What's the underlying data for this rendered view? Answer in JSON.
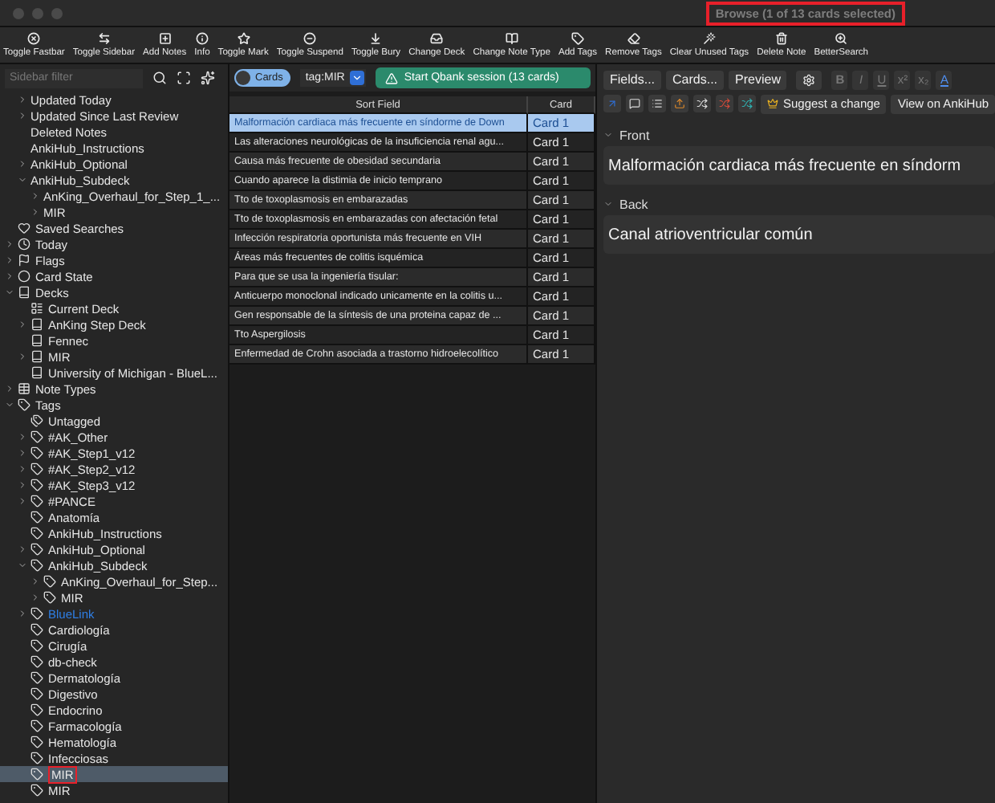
{
  "window": {
    "title": "Browse (1 of 13 cards selected)",
    "title_highlighted": true
  },
  "toolbar": [
    "Toggle Fastbar",
    "Toggle Sidebar",
    "Add Notes",
    "Info",
    "Toggle Mark",
    "Toggle Suspend",
    "Toggle Bury",
    "Change Deck",
    "Change Note Type",
    "Add Tags",
    "Remove Tags",
    "Clear Unused Tags",
    "Delete Note",
    "BetterSearch"
  ],
  "sidebar": {
    "filter_placeholder": "Sidebar filter",
    "partial_items": [
      {
        "label": "Updated Today",
        "expanded": false,
        "selected": false,
        "highlighted": false
      },
      {
        "label": "Updated Since Last Review",
        "expanded": false,
        "selected": false,
        "highlighted": false
      },
      {
        "label": "Deleted Notes",
        "selected": false,
        "highlighted": false
      },
      {
        "label": "AnkiHub_Instructions",
        "selected": false,
        "highlighted": false
      },
      {
        "label": "AnkiHub_Optional",
        "expanded": false,
        "selected": false,
        "highlighted": false
      },
      {
        "label": "AnkiHub_Subdeck",
        "expanded": true,
        "selected": false,
        "highlighted": false,
        "children": [
          {
            "label": "AnKing_Overhaul_for_Step_1_...",
            "expanded": false,
            "selected": false,
            "highlighted": false
          },
          {
            "label": "MIR",
            "expanded": false,
            "selected": false,
            "highlighted": false
          }
        ]
      }
    ],
    "items": [
      {
        "label": "Saved Searches",
        "kind": "saved",
        "selected": false,
        "highlighted": false
      },
      {
        "label": "Today",
        "kind": "today",
        "expanded": false,
        "selected": false,
        "highlighted": false
      },
      {
        "label": "Flags",
        "kind": "flags",
        "expanded": false,
        "selected": false,
        "highlighted": false
      },
      {
        "label": "Card State",
        "kind": "card-state",
        "expanded": false,
        "selected": false,
        "highlighted": false
      },
      {
        "label": "Decks",
        "kind": "deck",
        "expanded": true,
        "selected": false,
        "highlighted": false,
        "children": [
          {
            "label": "Current Deck",
            "kind": "current-deck",
            "selected": false,
            "highlighted": false
          },
          {
            "label": "AnKing Step Deck",
            "kind": "deck",
            "expanded": false,
            "selected": false,
            "highlighted": false
          },
          {
            "label": "Fennec",
            "kind": "deck",
            "selected": false,
            "highlighted": false
          },
          {
            "label": "MIR",
            "kind": "deck",
            "expanded": false,
            "selected": false,
            "highlighted": false
          },
          {
            "label": "University of Michigan - BlueL...",
            "kind": "deck",
            "selected": false,
            "highlighted": false
          }
        ]
      },
      {
        "label": "Note Types",
        "kind": "note-types",
        "expanded": false,
        "selected": false,
        "highlighted": false
      },
      {
        "label": "Tags",
        "kind": "tag",
        "expanded": true,
        "selected": false,
        "highlighted": false,
        "children": [
          {
            "label": "Untagged",
            "kind": "untagged",
            "selected": false,
            "highlighted": false
          },
          {
            "label": "#AK_Other",
            "kind": "tag",
            "expanded": false,
            "selected": false,
            "highlighted": false
          },
          {
            "label": "#AK_Step1_v12",
            "kind": "tag",
            "expanded": false,
            "selected": false,
            "highlighted": false
          },
          {
            "label": "#AK_Step2_v12",
            "kind": "tag",
            "expanded": false,
            "selected": false,
            "highlighted": false
          },
          {
            "label": "#AK_Step3_v12",
            "kind": "tag",
            "expanded": false,
            "selected": false,
            "highlighted": false
          },
          {
            "label": "#PANCE",
            "kind": "tag",
            "expanded": false,
            "selected": false,
            "highlighted": false
          },
          {
            "label": "Anatomía",
            "kind": "tag",
            "selected": false,
            "highlighted": false
          },
          {
            "label": "AnkiHub_Instructions",
            "kind": "tag",
            "selected": false,
            "highlighted": false
          },
          {
            "label": "AnkiHub_Optional",
            "kind": "tag",
            "expanded": false,
            "selected": false,
            "highlighted": false
          },
          {
            "label": "AnkiHub_Subdeck",
            "kind": "tag",
            "expanded": true,
            "selected": false,
            "highlighted": false,
            "children": [
              {
                "label": "AnKing_Overhaul_for_Step...",
                "kind": "tag",
                "expanded": false,
                "selected": false,
                "highlighted": false
              },
              {
                "label": "MIR",
                "kind": "tag",
                "expanded": false,
                "selected": false,
                "highlighted": false
              }
            ]
          },
          {
            "label": "BlueLink",
            "kind": "tag",
            "expanded": false,
            "selected": false,
            "highlighted": false,
            "color": "#2f7fe6"
          },
          {
            "label": "Cardiología",
            "kind": "tag",
            "selected": false,
            "highlighted": false
          },
          {
            "label": "Cirugía",
            "kind": "tag",
            "selected": false,
            "highlighted": false
          },
          {
            "label": "db-check",
            "kind": "tag",
            "selected": false,
            "highlighted": false
          },
          {
            "label": "Dermatología",
            "kind": "tag",
            "selected": false,
            "highlighted": false
          },
          {
            "label": "Digestivo",
            "kind": "tag",
            "selected": false,
            "highlighted": false
          },
          {
            "label": "Endocrino",
            "kind": "tag",
            "selected": false,
            "highlighted": false
          },
          {
            "label": "Farmacología",
            "kind": "tag",
            "selected": false,
            "highlighted": false
          },
          {
            "label": "Hematología",
            "kind": "tag",
            "selected": false,
            "highlighted": false
          },
          {
            "label": "Infecciosas",
            "kind": "tag",
            "selected": false,
            "highlighted": false
          },
          {
            "label": "MIR",
            "kind": "tag",
            "selected": true,
            "highlighted": true
          },
          {
            "label": "MIR",
            "kind": "tag",
            "selected": false,
            "highlighted": false
          }
        ]
      }
    ]
  },
  "search": {
    "mode_label": "Cards",
    "mode_on": true,
    "query": "tag:MIR",
    "qbank_button": "Start Qbank session (13 cards)"
  },
  "table": {
    "columns": [
      "Sort Field",
      "Card"
    ],
    "rows": [
      {
        "cells": [
          "Malformación cardiaca más frecuente en síndorme de Down",
          "Card 1"
        ],
        "selected": true
      },
      {
        "cells": [
          "Las alteraciones neurológicas de la insuficiencia renal agu...",
          "Card 1"
        ],
        "selected": false
      },
      {
        "cells": [
          "Causa más frecuente de obesidad secundaria",
          "Card 1"
        ],
        "selected": false
      },
      {
        "cells": [
          "Cuando aparece la distimia de inicio temprano",
          "Card 1"
        ],
        "selected": false
      },
      {
        "cells": [
          "Tto de toxoplasmosis en embarazadas",
          "Card 1"
        ],
        "selected": false
      },
      {
        "cells": [
          "Tto de toxoplasmosis en embarazadas con afectación fetal",
          "Card 1"
        ],
        "selected": false
      },
      {
        "cells": [
          "Infección respiratoria oportunista más frecuente en VIH",
          "Card 1"
        ],
        "selected": false
      },
      {
        "cells": [
          "Áreas más frecuentes de colitis isquémica",
          "Card 1"
        ],
        "selected": false
      },
      {
        "cells": [
          "Para que se usa la ingeniería tisular:",
          "Card 1"
        ],
        "selected": false
      },
      {
        "cells": [
          "Anticuerpo monoclonal indicado unicamente en la colitis u...",
          "Card 1"
        ],
        "selected": false
      },
      {
        "cells": [
          "Gen responsable de la síntesis de una proteina capaz de ...",
          "Card 1"
        ],
        "selected": false
      },
      {
        "cells": [
          "Tto Aspergilosis",
          "Card 1"
        ],
        "selected": false
      },
      {
        "cells": [
          "Enfermedad de Crohn asociada a trastorno hidroelecolítico",
          "Card 1"
        ],
        "selected": false
      }
    ]
  },
  "editor": {
    "buttons": [
      "Fields...",
      "Cards...",
      "Preview"
    ],
    "format_buttons": [
      {
        "label": "B",
        "disabled": true
      },
      {
        "label": "I",
        "disabled": true
      },
      {
        "label": "U",
        "disabled": true
      },
      {
        "label": "x²",
        "disabled": true
      },
      {
        "label": "x₂",
        "disabled": true
      },
      {
        "label": "A",
        "disabled": false
      }
    ],
    "actions": [
      "Suggest a change",
      "View on AnkiHub"
    ],
    "fields": [
      {
        "name": "Front",
        "expanded": true,
        "value": "Malformación cardiaca más frecuente en síndorm"
      },
      {
        "name": "Back",
        "expanded": true,
        "value": "Canal atrioventricular común"
      }
    ]
  }
}
